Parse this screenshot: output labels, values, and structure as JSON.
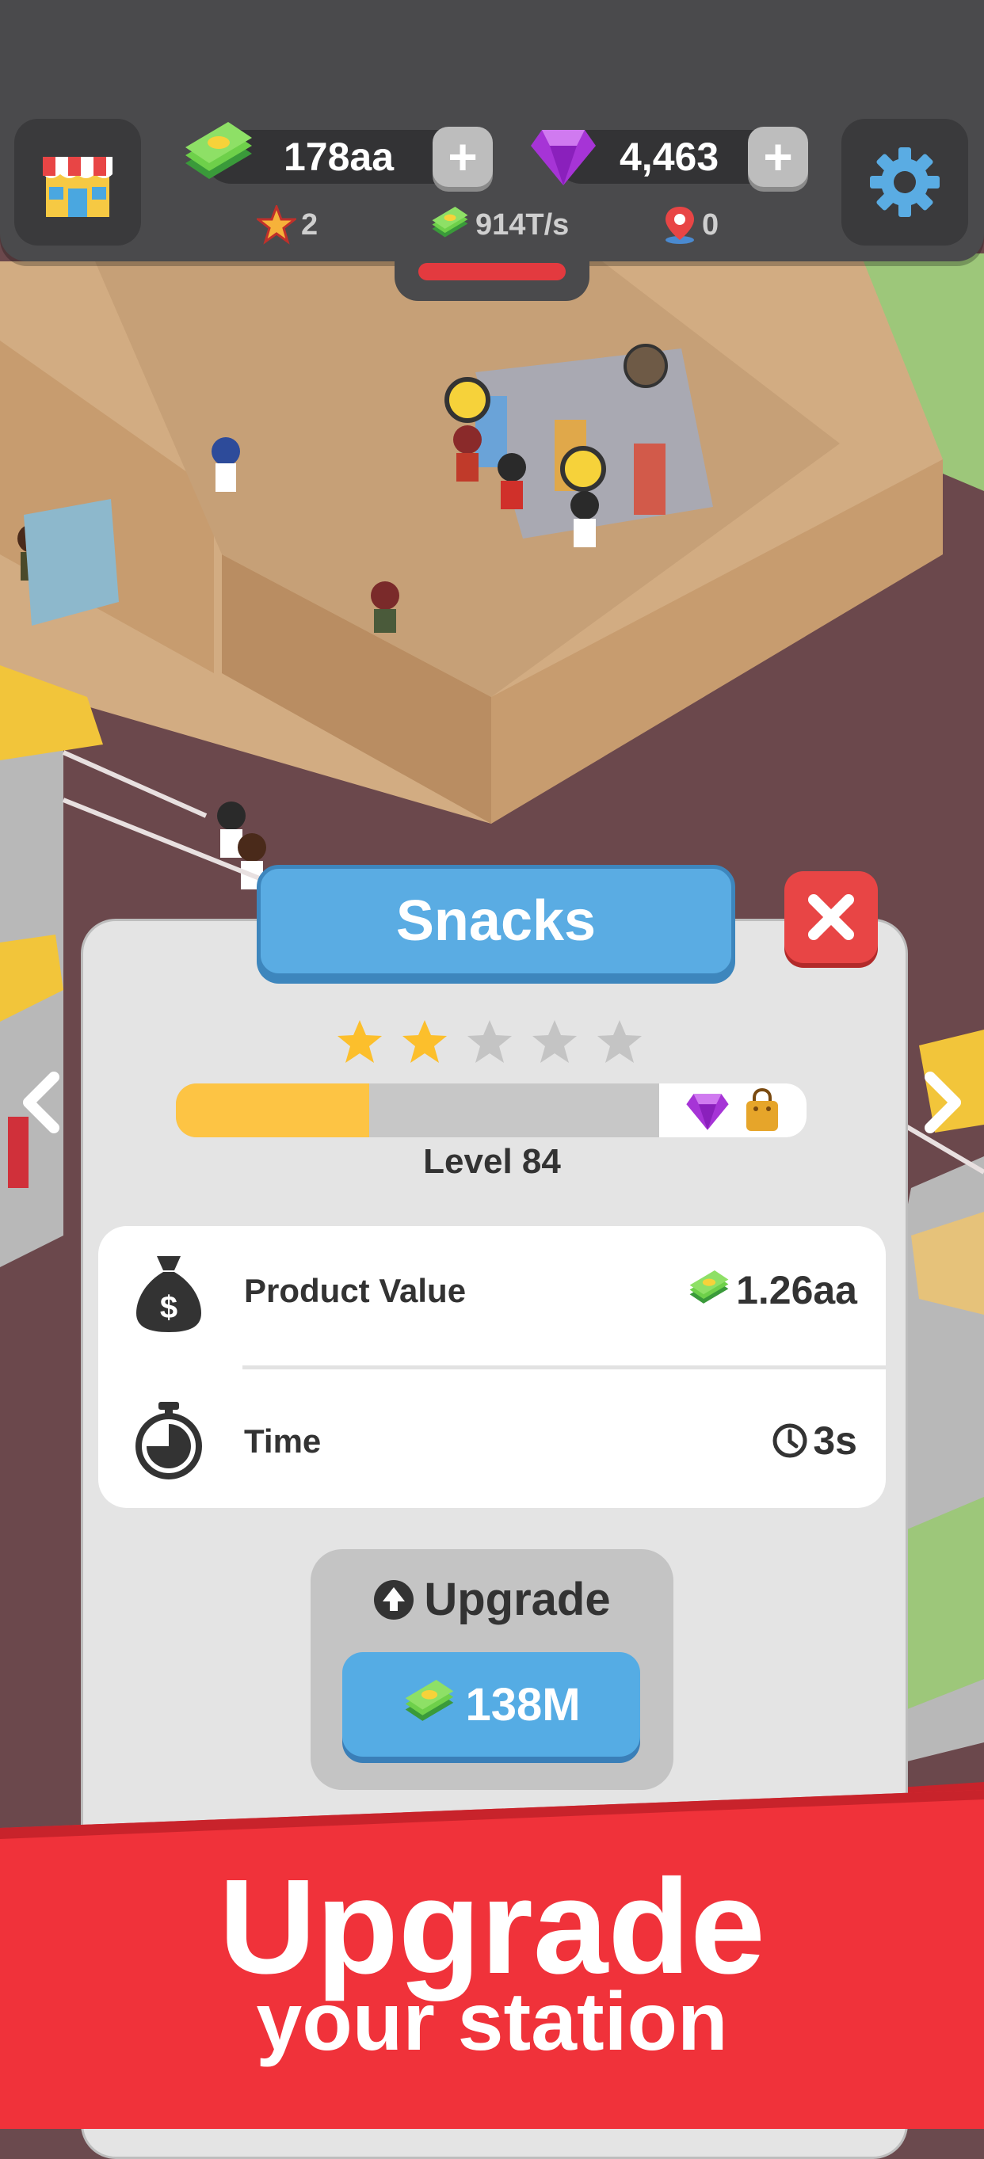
{
  "hud": {
    "cash": "178aa",
    "gems": "4,463",
    "stars": "2",
    "income_rate": "914T/s",
    "locations": "0",
    "add_label": "+"
  },
  "station": {
    "title": "Snacks",
    "rating_stars": 2,
    "rating_max": 5,
    "level_progress": 0.4,
    "level_label": "Level 84",
    "product_value_label": "Product Value",
    "product_value": "1.26aa",
    "time_label": "Time",
    "time_value": "3s",
    "upgrade_label": "Upgrade",
    "upgrade_cost": "138M"
  },
  "banner": {
    "line1": "Upgrade",
    "line2": "your station"
  },
  "colors": {
    "accent_blue": "#5aace3",
    "close_red": "#e84545",
    "banner_red": "#f0323a",
    "progress_yellow": "#fdc444",
    "star_gold": "#fcbf2c"
  }
}
